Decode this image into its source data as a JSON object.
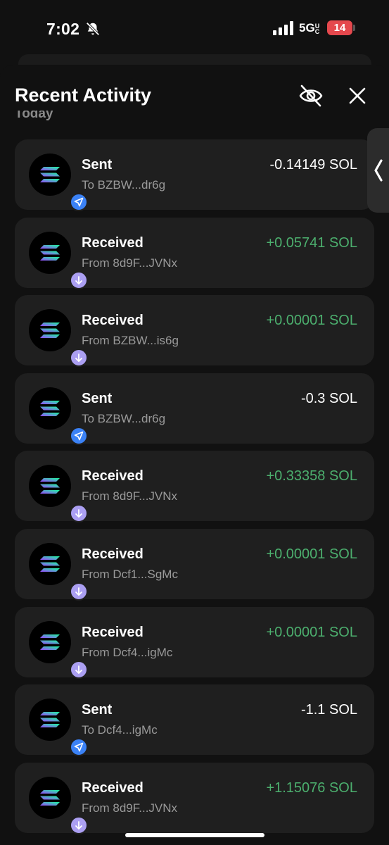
{
  "status_bar": {
    "time": "7:02",
    "network": "5G",
    "network_sub": "UC",
    "battery": "14"
  },
  "header": {
    "title": "Recent Activity"
  },
  "section_label": "Today",
  "colors": {
    "positive": "#4caf6e",
    "sent_badge": "#3b82f6",
    "received_badge": "#ab9ff2",
    "card": "#1f1f1f",
    "background": "#111111"
  },
  "activity": [
    {
      "type": "sent",
      "kind": "Sent",
      "party": "To BZBW...dr6g",
      "amount": "-0.14149 SOL",
      "icon": "send-arrow-icon"
    },
    {
      "type": "received",
      "kind": "Received",
      "party": "From 8d9F...JVNx",
      "amount": "+0.05741 SOL",
      "icon": "down-arrow-icon"
    },
    {
      "type": "received",
      "kind": "Received",
      "party": "From BZBW...is6g",
      "amount": "+0.00001 SOL",
      "icon": "down-arrow-icon"
    },
    {
      "type": "sent",
      "kind": "Sent",
      "party": "To BZBW...dr6g",
      "amount": "-0.3 SOL",
      "icon": "send-arrow-icon"
    },
    {
      "type": "received",
      "kind": "Received",
      "party": "From 8d9F...JVNx",
      "amount": "+0.33358 SOL",
      "icon": "down-arrow-icon"
    },
    {
      "type": "received",
      "kind": "Received",
      "party": "From Dcf1...SgMc",
      "amount": "+0.00001 SOL",
      "icon": "down-arrow-icon"
    },
    {
      "type": "received",
      "kind": "Received",
      "party": "From Dcf4...igMc",
      "amount": "+0.00001 SOL",
      "icon": "down-arrow-icon"
    },
    {
      "type": "sent",
      "kind": "Sent",
      "party": "To Dcf4...igMc",
      "amount": "-1.1 SOL",
      "icon": "send-arrow-icon"
    },
    {
      "type": "received",
      "kind": "Received",
      "party": "From 8d9F...JVNx",
      "amount": "+1.15076 SOL",
      "icon": "down-arrow-icon"
    }
  ]
}
